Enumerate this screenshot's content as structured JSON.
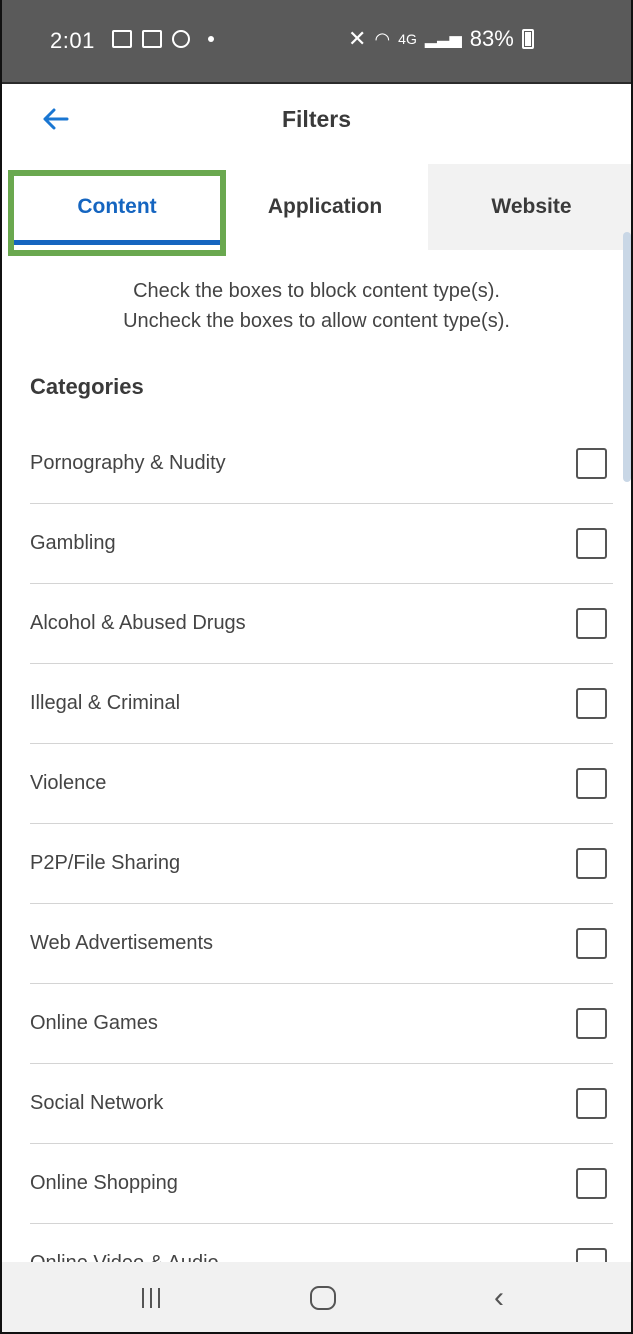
{
  "status_bar": {
    "time": "2:01",
    "battery": "83%",
    "network": "4G"
  },
  "header": {
    "back_icon": "arrow-left-icon",
    "title": "Filters"
  },
  "tabs": [
    {
      "label": "Content",
      "selected": true
    },
    {
      "label": "Application",
      "selected": false
    },
    {
      "label": "Website",
      "selected": false
    }
  ],
  "instructions": {
    "line1": "Check the boxes to block content type(s).",
    "line2": "Uncheck the boxes to allow content type(s)."
  },
  "section_heading": "Categories",
  "categories": [
    {
      "label": "Pornography & Nudity",
      "checked": false
    },
    {
      "label": "Gambling",
      "checked": false
    },
    {
      "label": "Alcohol & Abused Drugs",
      "checked": false
    },
    {
      "label": "Illegal & Criminal",
      "checked": false
    },
    {
      "label": "Violence",
      "checked": false
    },
    {
      "label": "P2P/File Sharing",
      "checked": false
    },
    {
      "label": "Web Advertisements",
      "checked": false
    },
    {
      "label": "Online Games",
      "checked": false
    },
    {
      "label": "Social Network",
      "checked": false
    },
    {
      "label": "Online Shopping",
      "checked": false
    },
    {
      "label": "Online Video & Audio",
      "checked": false
    }
  ],
  "colors": {
    "accent": "#1565c0",
    "highlight": "#6aa84f",
    "status_bar": "#5a5a5a"
  }
}
